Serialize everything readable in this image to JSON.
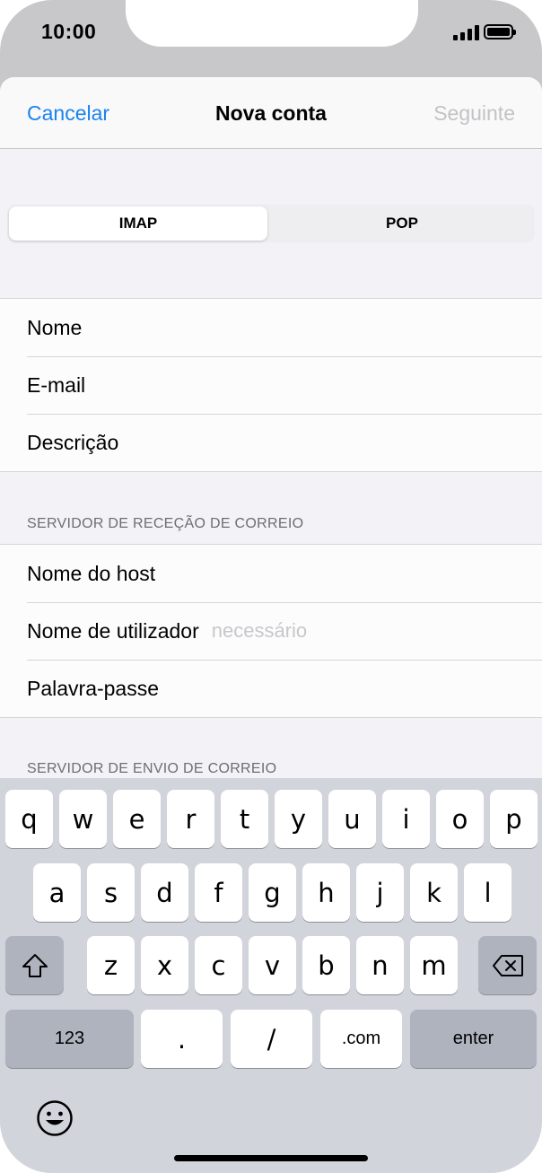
{
  "status_bar": {
    "time": "10:00"
  },
  "nav": {
    "cancel": "Cancelar",
    "title": "Nova conta",
    "next": "Seguinte"
  },
  "segmented": {
    "imap": "IMAP",
    "pop": "POP",
    "selected": "IMAP"
  },
  "account_fields": [
    "Nome",
    "E-mail",
    "Descrição"
  ],
  "incoming": {
    "header": "SERVIDOR DE RECEÇÃO DE CORREIO",
    "fields": [
      {
        "label": "Nome do host",
        "placeholder": ""
      },
      {
        "label": "Nome de utilizador",
        "placeholder": "necessário"
      },
      {
        "label": "Palavra-passe",
        "placeholder": ""
      }
    ]
  },
  "outgoing": {
    "header": "SERVIDOR DE ENVIO DE CORREIO"
  },
  "keyboard": {
    "row1": [
      "q",
      "w",
      "e",
      "r",
      "t",
      "y",
      "u",
      "i",
      "o",
      "p"
    ],
    "row2": [
      "a",
      "s",
      "d",
      "f",
      "g",
      "h",
      "j",
      "k",
      "l"
    ],
    "row3": [
      "z",
      "x",
      "c",
      "v",
      "b",
      "n",
      "m"
    ],
    "numbers": "123",
    "dot": ".",
    "slash": "/",
    "dotcom": ".com",
    "enter": "enter"
  },
  "colors": {
    "accent": "#1a83f0",
    "disabled": "#c3c3c7",
    "keyboard_bg": "#d1d4db"
  }
}
